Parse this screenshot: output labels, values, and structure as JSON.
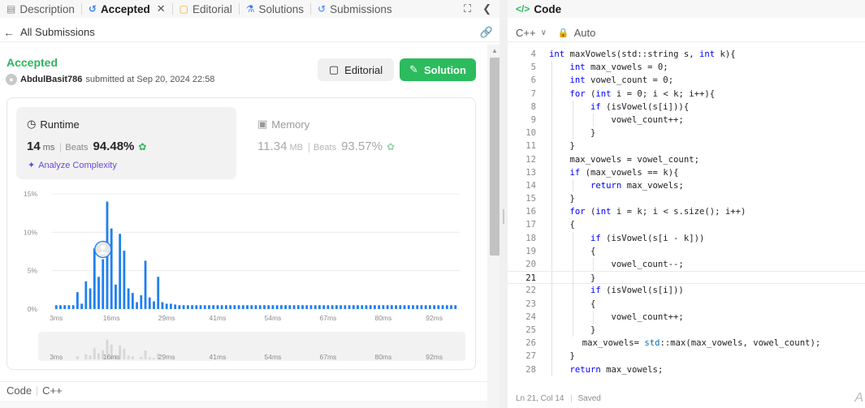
{
  "tabs": [
    {
      "label": "Description",
      "icon": "description-icon"
    },
    {
      "label": "Accepted",
      "icon": "history-icon",
      "active": true
    },
    {
      "label": "Editorial",
      "icon": "book-icon"
    },
    {
      "label": "Solutions",
      "icon": "flask-icon"
    },
    {
      "label": "Submissions",
      "icon": "history-icon"
    }
  ],
  "subheader": {
    "back_label": "All Submissions"
  },
  "submission": {
    "status": "Accepted",
    "username": "AbdulBasit786",
    "submitted_text": "submitted at Sep 20, 2024 22:58"
  },
  "buttons": {
    "editorial": "Editorial",
    "solution": "Solution"
  },
  "runtime": {
    "label": "Runtime",
    "value": "14",
    "unit": "ms",
    "beats_label": "Beats",
    "beats_pct": "94.48%"
  },
  "memory": {
    "label": "Memory",
    "value": "11.34",
    "unit": "MB",
    "beats_label": "Beats",
    "beats_pct": "93.57%"
  },
  "analyze_label": "Analyze Complexity",
  "colors": {
    "accent_green": "#2cbb5d",
    "bar_blue": "#1f7ff0",
    "purple": "#6b48d8"
  },
  "chart_data": {
    "type": "bar",
    "ylabels": [
      "15%",
      "10%",
      "5%",
      "0%"
    ],
    "yticks": [
      15,
      10,
      5,
      0
    ],
    "ylim": [
      0,
      15
    ],
    "xlabels": [
      "3ms",
      "16ms",
      "29ms",
      "41ms",
      "54ms",
      "67ms",
      "80ms",
      "92ms"
    ],
    "xticks": [
      3,
      16,
      29,
      41,
      54,
      67,
      80,
      92
    ],
    "xlim": [
      2,
      98
    ],
    "bins": [
      3,
      4,
      5,
      6,
      7,
      8,
      9,
      10,
      11,
      12,
      13,
      14,
      15,
      16,
      17,
      18,
      19,
      20,
      21,
      22,
      23,
      24,
      25,
      26,
      27,
      28,
      29,
      30,
      31,
      32,
      33,
      34,
      35,
      36,
      37,
      38,
      39,
      40,
      41,
      42,
      43,
      44,
      45,
      46,
      47,
      48,
      49,
      50,
      51,
      52,
      53,
      54,
      55,
      56,
      57,
      58,
      59,
      60,
      61,
      62,
      63,
      64,
      65,
      66,
      67,
      68,
      69,
      70,
      71,
      72,
      73,
      74,
      75,
      76,
      77,
      78,
      79,
      80,
      81,
      82,
      83,
      84,
      85,
      86,
      87,
      88,
      89,
      90,
      91,
      92,
      93,
      94,
      95,
      96,
      97
    ],
    "values": [
      0.5,
      0.5,
      0.5,
      0.5,
      0.5,
      2.2,
      0.7,
      3.6,
      2.7,
      7.9,
      4.2,
      6.5,
      14.0,
      10.5,
      3.2,
      9.8,
      7.6,
      2.7,
      2.1,
      0.9,
      1.8,
      6.3,
      1.5,
      1.0,
      4.2,
      0.9,
      0.7,
      0.7,
      0.6,
      0.5,
      0.5,
      0.5,
      0.5,
      0.5,
      0.5,
      0.5,
      0.5,
      0.5,
      0.5,
      0.5,
      0.5,
      0.5,
      0.5,
      0.5,
      0.5,
      0.5,
      0.5,
      0.5,
      0.5,
      0.5,
      0.5,
      0.5,
      0.5,
      0.5,
      0.5,
      0.5,
      0.5,
      0.5,
      0.5,
      0.5,
      0.5,
      0.5,
      0.5,
      0.5,
      0.5,
      0.5,
      0.5,
      0.5,
      0.5,
      0.5,
      0.5,
      0.5,
      0.5,
      0.5,
      0.5,
      0.5,
      0.5,
      0.5,
      0.5,
      0.5,
      0.5,
      0.5,
      0.5,
      0.5,
      0.5,
      0.5,
      0.5,
      0.5,
      0.5,
      0.5,
      0.5,
      0.5,
      0.5,
      0.5,
      0.5
    ],
    "marker_bin": 14,
    "grid": true,
    "overview_xlabels": [
      "3ms",
      "16ms",
      "29ms",
      "41ms",
      "54ms",
      "67ms",
      "80ms",
      "92ms"
    ]
  },
  "bottom": {
    "code_label": "Code",
    "lang": "C++"
  },
  "editor": {
    "title": "Code",
    "language": "C++",
    "auto_label": "Auto",
    "lines": [
      {
        "n": "4",
        "indent": 1,
        "html": "<span class=\"kw\">int</span> maxVowels(std::string s, <span class=\"kw\">int</span> k){"
      },
      {
        "n": "5",
        "indent": 2,
        "html": "<span class=\"kw\">int</span> max_vowels = 0;"
      },
      {
        "n": "6",
        "indent": 2,
        "html": "<span class=\"kw\">int</span> vowel_count = 0;"
      },
      {
        "n": "7",
        "indent": 2,
        "html": "<span class=\"kw\">for</span> (<span class=\"kw\">int</span> i = 0; i &lt; k; i++){"
      },
      {
        "n": "8",
        "indent": 3,
        "html": "<span class=\"kw\">if</span> (isVowel(s[i])){"
      },
      {
        "n": "9",
        "indent": 4,
        "html": "vowel_count++;"
      },
      {
        "n": "10",
        "indent": 3,
        "html": "}"
      },
      {
        "n": "11",
        "indent": 2,
        "html": "}"
      },
      {
        "n": "12",
        "indent": 2,
        "html": "max_vowels = vowel_count;"
      },
      {
        "n": "13",
        "indent": 2,
        "html": "<span class=\"kw\">if</span> (max_vowels == k){"
      },
      {
        "n": "14",
        "indent": 3,
        "html": "<span class=\"kw\">return</span> max_vowels;"
      },
      {
        "n": "15",
        "indent": 2,
        "html": "}"
      },
      {
        "n": "16",
        "indent": 2,
        "html": "<span class=\"kw\">for</span> (<span class=\"kw\">int</span> i = k; i &lt; s.size(); i++)"
      },
      {
        "n": "17",
        "indent": 2,
        "html": "{"
      },
      {
        "n": "18",
        "indent": 3,
        "html": "<span class=\"kw\">if</span> (isVowel(s[i - k]))"
      },
      {
        "n": "19",
        "indent": 3,
        "html": "{"
      },
      {
        "n": "20",
        "indent": 4,
        "html": "vowel_count--;"
      },
      {
        "n": "21",
        "indent": 3,
        "html": "}",
        "current": true
      },
      {
        "n": "22",
        "indent": 3,
        "html": "<span class=\"kw\">if</span> (isVowel(s[i]))"
      },
      {
        "n": "23",
        "indent": 3,
        "html": "{"
      },
      {
        "n": "24",
        "indent": 4,
        "html": "vowel_count++;"
      },
      {
        "n": "25",
        "indent": 3,
        "html": "}"
      },
      {
        "n": "26",
        "indent": 2.6,
        "html": "max_vowels= <span class=\"gl\">std</span>::max(max_vowels, vowel_count);"
      },
      {
        "n": "27",
        "indent": 2,
        "html": "}"
      },
      {
        "n": "28",
        "indent": 2,
        "html": "<span class=\"kw\">return</span> max_vowels;"
      }
    ],
    "status_pos": "Ln 21, Col 14",
    "status_saved": "Saved"
  }
}
